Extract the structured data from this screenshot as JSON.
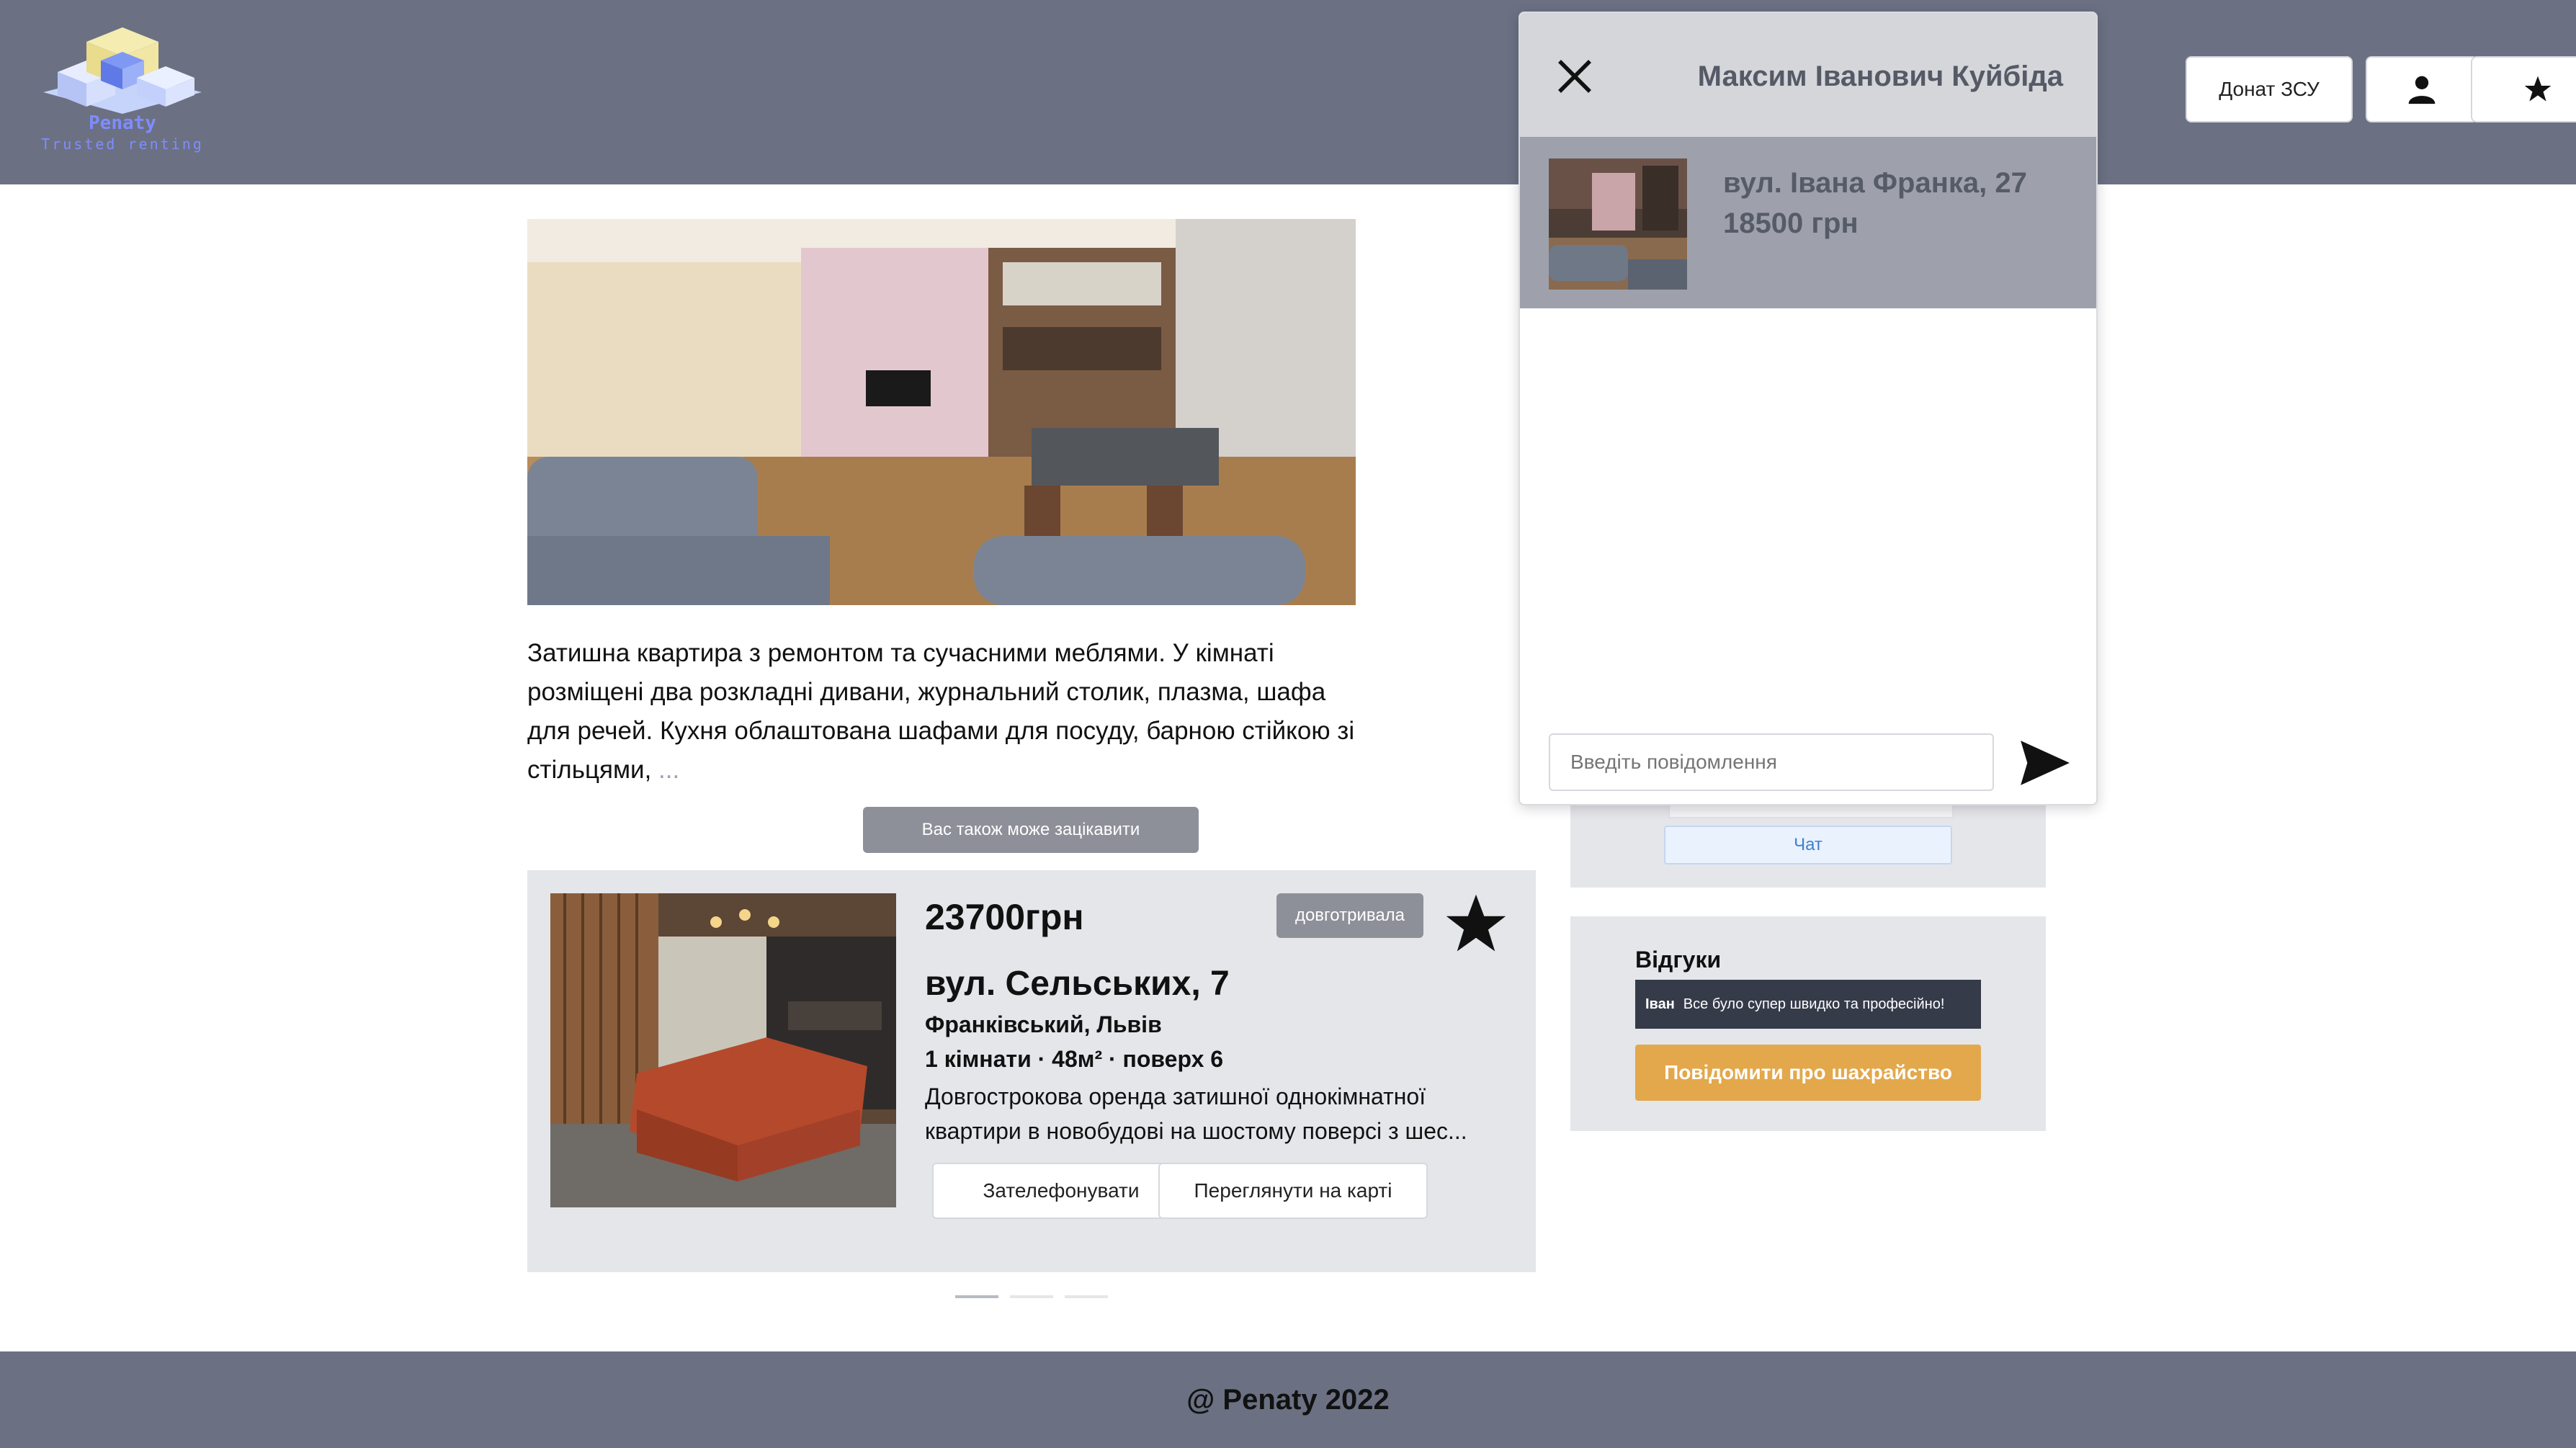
{
  "header": {
    "logo_name": "Penaty",
    "logo_tagline": "Trusted renting",
    "donate_label": "Донат ЗСУ",
    "user_icon": "user-icon",
    "favorites_icon": "star-icon"
  },
  "listing": {
    "description": "Затишна квартира з ремонтом та сучасними меблями. У кімнаті розміщені два розкладні дивани, журнальний столик, плазма, шафа для речей. Кухня облаштована шафами для посуду, барною стійкою зі стільцями,",
    "more": " ..."
  },
  "suggestions": {
    "button_label": "Вас також може зацікавити",
    "card": {
      "price": "23700грн",
      "term": "довготривала",
      "street": "вул. Сельських, 7",
      "district": "Франківський, Львів",
      "details": "1 кімнати · 48м² · поверх 6",
      "description": "Довгострокова оренда затишної однокімнатної квартири в новобудові на шостому поверсі з шес...",
      "call_label": "Зателефонувати",
      "map_label": "Переглянути на карті"
    },
    "pagination": {
      "total": 3,
      "active": 1
    }
  },
  "owner": {
    "chat_label": "Чат"
  },
  "reviews": {
    "title": "Відгуки",
    "items": [
      {
        "author": "Іван",
        "text": "Все було супер швидко та професійно!"
      }
    ],
    "report_label": "Повідомити про шахрайство"
  },
  "chat": {
    "contact_name": "Максим Іванович Куйбіда",
    "listing_address": "вул. Івана Франка, 27",
    "listing_price": "18500 грн",
    "input_placeholder": "Введіть повідомлення"
  },
  "footer": {
    "text": "@ Penaty 2022"
  },
  "colors": {
    "header_bg": "#6b7183",
    "panel_bg": "#e5e6ea",
    "badge_bg": "#8e9099",
    "report_bg": "#e3a84b",
    "chat_link": "#3d7fd4"
  }
}
